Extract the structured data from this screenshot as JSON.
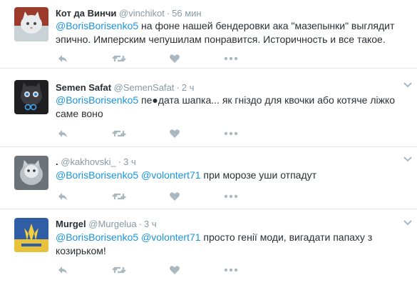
{
  "tweets": [
    {
      "name": "Кот да Винчи",
      "handle": "@vinchikot",
      "separator": "·",
      "time": "56 мин",
      "mentions": [
        "@BorisBorisenko5"
      ],
      "text_line1_after_mentions": " на фоне нашей бендеровки ака \"мазепынки\" выглядит",
      "text_line2": "эпично. Имперским чепушилам понравится. Историчность и все такое."
    },
    {
      "name": "Semen Safat",
      "handle": "@SemenSafat",
      "separator": "·",
      "time": "2 ч",
      "mentions": [
        "@BorisBorisenko5"
      ],
      "text_line1_after_mentions": " пе●дата шапка... як гніздо для  квочки або котяче ліжко",
      "text_line2": "саме воно"
    },
    {
      "name": ".",
      "handle": "@kakhovski_",
      "separator": "·",
      "time": "3 ч",
      "mentions": [
        "@BorisBorisenko5",
        "@volontert71"
      ],
      "text_line1_after_mentions": " при морозе уши отпадут",
      "text_line2": ""
    },
    {
      "name": "Murgel",
      "handle": "@Murgelua",
      "separator": "·",
      "time": "3 ч",
      "mentions": [
        "@BorisBorisenko5",
        "@volontert71"
      ],
      "text_line1_after_mentions": " просто генії моди, вигадати папаху з",
      "text_line2": "козирьком!"
    }
  ],
  "icons": {
    "reply": "reply-icon",
    "retweet": "retweet-icon",
    "like": "heart-icon",
    "more": "more-icon",
    "caret": "chevron-down-icon"
  },
  "colors": {
    "text": "#292f33",
    "mention": "#1b95e0",
    "meta": "#8899a6",
    "action_icon": "#aab8c2",
    "divider": "#e1e8ed"
  }
}
